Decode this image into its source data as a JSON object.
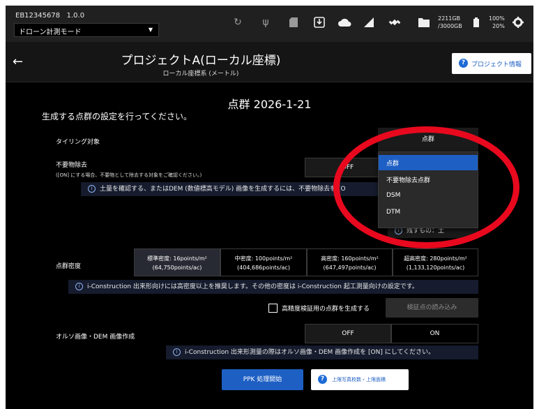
{
  "statusbar": {
    "device_id": "EB12345678",
    "version": "1.0.0",
    "mode": "ドローン計測モード",
    "storage_used": "2211GB",
    "storage_total": "/3000GB",
    "battery_1": "100%",
    "battery_2": "20%",
    "icons": [
      "refresh-icon",
      "usb-icon",
      "sd-card-icon",
      "download-icon",
      "cloud-icon",
      "signal-icon",
      "satellite-icon",
      "folder-icon",
      "battery-icon",
      "gear-icon"
    ]
  },
  "header": {
    "title": "プロジェクトA(ローカル座標)",
    "subtitle": "ローカル座標系 (メートル)",
    "info_button": "プロジェクト情報"
  },
  "page": {
    "title": "点群 2026-1-21",
    "instruction": "生成する点群の設定を行ってください。"
  },
  "tiling": {
    "label": "タイリング対象",
    "selected": "点群",
    "options": [
      "点群",
      "不要物除去点群",
      "DSM",
      "DTM"
    ]
  },
  "noise": {
    "label": "不要物除去",
    "sublabel": "([ON] にする場合、不要物として除去する対象をご確認ください。)",
    "off": "OFF",
    "note": "土量を確認する、またはDEM (数値標高モデル) 画像を生成するには、不要物除去を [O",
    "residue": "残すもの：土"
  },
  "density": {
    "label": "点群密度",
    "options": [
      {
        "line1": "標準密度: 16points/m²",
        "line2": "(64,750points/ac)"
      },
      {
        "line1": "中密度: 100points/m²",
        "line2": "(404,686points/ac)"
      },
      {
        "line1": "高密度: 160points/m²",
        "line2": "(647,497points/ac)"
      },
      {
        "line1": "超高密度: 280points/m²",
        "line2": "(1,133,120points/ac)"
      }
    ],
    "note": "i-Construction 出来形向けには高密度以上を推奨します。その他の密度は i-Construction 起工測量向けの設定です。",
    "checkbox_label": "高精度検証用の点群を生成する",
    "verify_button": "検証点の読み込み"
  },
  "ortho": {
    "label": "オルソ画像・DEM 画像作成",
    "off": "OFF",
    "on": "ON",
    "note": "i-Construction 出来形測量の際はオルソ画像・DEM 画像作成を [ON] にしてください。"
  },
  "actions": {
    "ppk": "PPK 処理開始",
    "limit": "上限写真枚数・上限面積"
  },
  "info_glyph": "i",
  "q_glyph": "?"
}
